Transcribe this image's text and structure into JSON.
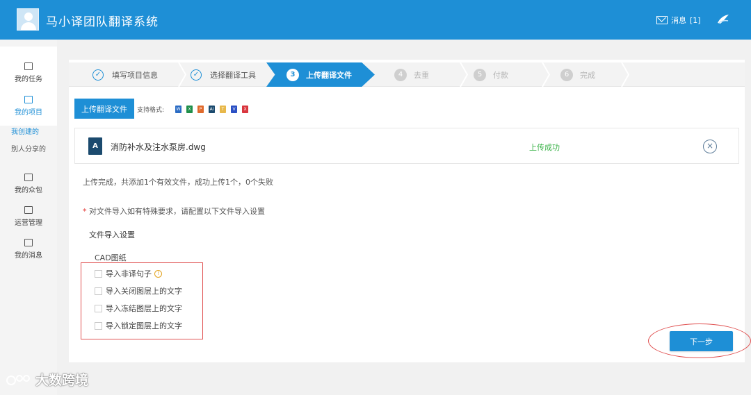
{
  "header": {
    "app_title": "马小译团队翻译系统",
    "message_label": "消息",
    "message_count": "[1]"
  },
  "sidebar": {
    "items": [
      {
        "label": "我的任务",
        "icon": "edit-icon"
      },
      {
        "label": "我的项目",
        "icon": "folder-icon",
        "active": true
      },
      {
        "label": "我的众包",
        "icon": "folder-icon"
      },
      {
        "label": "运营管理",
        "icon": "mail-icon"
      },
      {
        "label": "我的消息",
        "icon": "mail-icon"
      }
    ],
    "sub_items": [
      {
        "label": "我创建的",
        "active": true
      },
      {
        "label": "别人分享的",
        "active": false
      }
    ]
  },
  "steps": [
    {
      "label": "填写项目信息",
      "state": "done"
    },
    {
      "label": "选择翻译工具",
      "state": "done"
    },
    {
      "number": "3",
      "label": "上传翻译文件",
      "state": "current"
    },
    {
      "number": "4",
      "label": "去重",
      "state": "todo"
    },
    {
      "number": "5",
      "label": "付款",
      "state": "todo"
    },
    {
      "number": "6",
      "label": "完成",
      "state": "todo"
    }
  ],
  "upload": {
    "button_label": "上传翻译文件",
    "formats_label": "支持格式:",
    "formats": [
      {
        "letter": "W",
        "color": "#2b6cc4"
      },
      {
        "letter": "X",
        "color": "#1f8f4a"
      },
      {
        "letter": "P",
        "color": "#e06a2c"
      },
      {
        "letter": "Ai",
        "color": "#1b4a6e"
      },
      {
        "letter": "T",
        "color": "#e8b84a"
      },
      {
        "letter": "V",
        "color": "#2b50c4"
      },
      {
        "letter": "X",
        "color": "#d9363e"
      }
    ]
  },
  "file": {
    "name": "消防补水及注水泵房.dwg",
    "icon_letter": "A",
    "status": "上传成功"
  },
  "summary": "上传完成，共添加1个有效文件，成功上传1个，0个失败",
  "note": {
    "star": "*",
    "text": "对文件导入如有特殊要求，请配置以下文件导入设置"
  },
  "settings_title": "文件导入设置",
  "cad": {
    "title": "CAD图纸",
    "options": [
      {
        "label": "导入非译句子",
        "checked": false,
        "info": true
      },
      {
        "label": "导入关闭图层上的文字",
        "checked": false
      },
      {
        "label": "导入冻结图层上的文字",
        "checked": false
      },
      {
        "label": "导入锁定图层上的文字",
        "checked": false
      }
    ]
  },
  "next_label": "下一步",
  "watermark": "大数跨境",
  "colors": {
    "primary": "#1e8fd6",
    "success": "#3cb34a",
    "annotation": "#e05050"
  }
}
